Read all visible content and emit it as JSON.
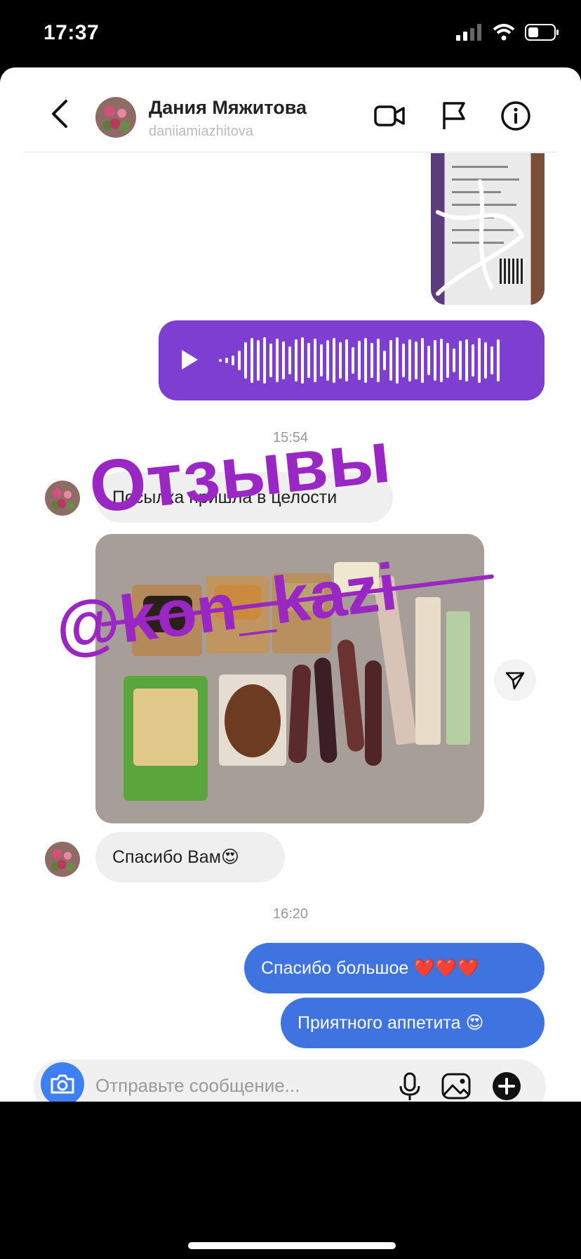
{
  "status_bar": {
    "time": "17:37"
  },
  "header": {
    "contact_name": "Дания Мяжитова",
    "contact_username": "daniiamiazhitova",
    "icons": [
      "back-icon",
      "video-call-icon",
      "flag-icon",
      "info-icon"
    ]
  },
  "messages": {
    "timestamp_1": "15:54",
    "incoming_1": "Посылка пришла в целости",
    "incoming_2": "Спасибо Вам😍",
    "timestamp_2": "16:20",
    "outgoing_1": "Спасибо большое ❤️❤️❤️",
    "outgoing_2": "Приятного аппетита 😍"
  },
  "composer": {
    "placeholder": "Отправьте сообщение..."
  },
  "overlay": {
    "title": "Отзывы",
    "handle": "@kon_kazi"
  },
  "colors": {
    "accent_purple": "#9a27c3",
    "voice_bubble": "#7e3ed1",
    "outgoing_bubble": "#3e73e0"
  }
}
